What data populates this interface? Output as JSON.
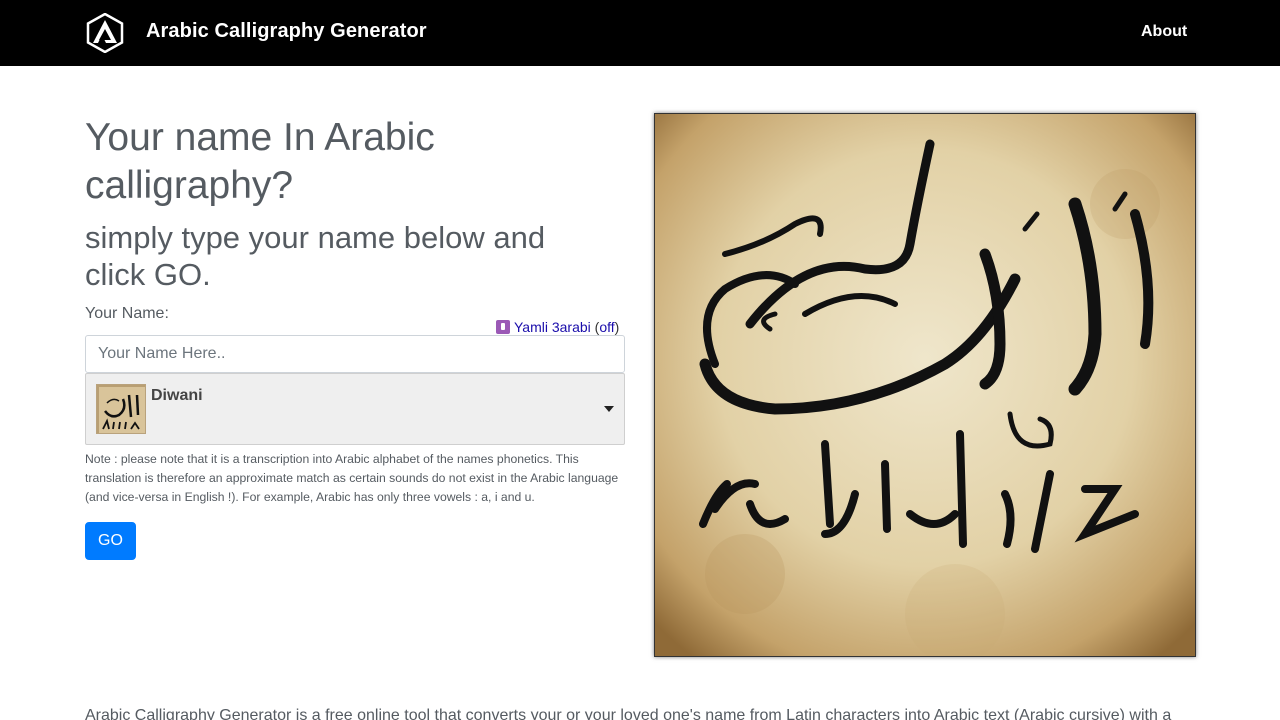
{
  "navbar": {
    "brand_title": "Arabic Calligraphy Generator",
    "about_label": "About",
    "logo_icon": "letter-a-hexagon-logo"
  },
  "hero": {
    "headline": "Your name In Arabic calligraphy?",
    "subline": "simply type your name below and click GO."
  },
  "form": {
    "name_label": "Your Name:",
    "name_placeholder": "Your Name Here..",
    "name_value": "",
    "yamli": {
      "icon": "yamli-icon",
      "link_text": "Yamli 3arabi",
      "open_paren": "(",
      "toggle_text": "off",
      "close_paren": ")"
    },
    "font_select": {
      "selected": "Diwani",
      "caret_icon": "caret-down-icon"
    },
    "note": "Note : please note that it is a transcription into Arabic alphabet of the names phonetics. This translation is therefore an approximate match as certain sounds do not exist in the Arabic language (and vice-versa in English !). For example, Arabic has only three vowels : a, i and u.",
    "go_label": "GO"
  },
  "preview": {
    "image_name": "diwani-calligraphy-sample",
    "colors": {
      "parchment_light": "#eee3c4",
      "parchment_dark": "#a8844e",
      "ink": "#111111"
    }
  },
  "footer": {
    "description": "Arabic Calligraphy Generator is a free online tool that converts your or your loved one's name from Latin characters into Arabic text (Arabic cursive) with a"
  },
  "colors": {
    "navbar_bg": "#000000",
    "primary": "#007bff",
    "heading_text": "#555b61"
  }
}
